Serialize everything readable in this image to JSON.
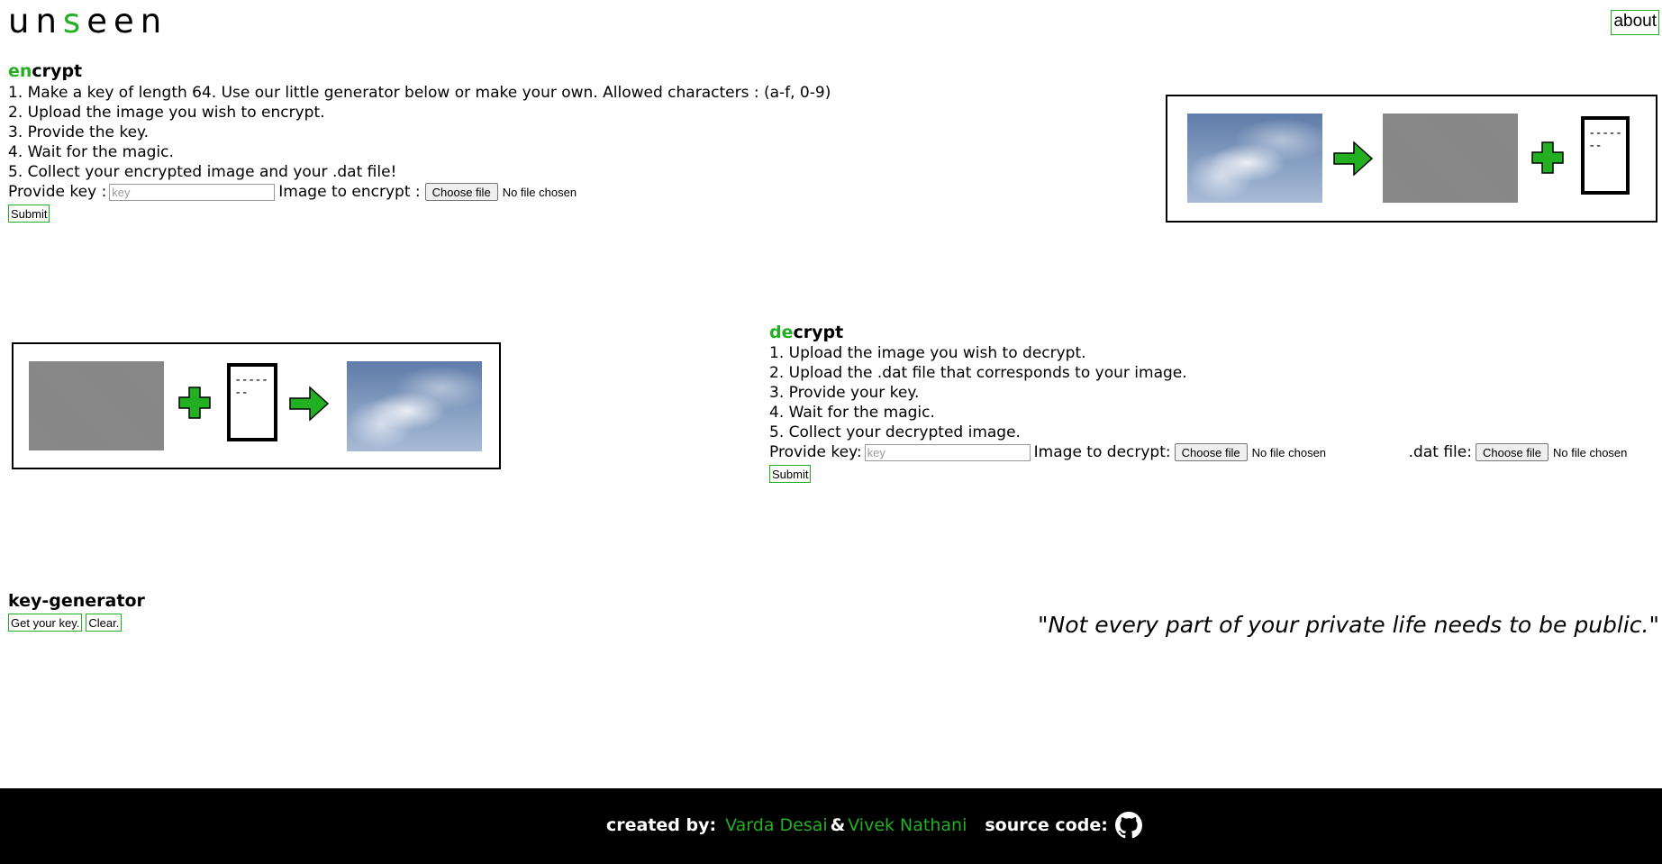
{
  "header": {
    "logo_parts": [
      "un",
      "s",
      "een"
    ],
    "about_label": "about"
  },
  "encrypt": {
    "title_accent": "en",
    "title_rest": "crypt",
    "steps": [
      "1. Make a key of length 64. Use our little generator below or make your own. Allowed characters : (a-f, 0-9)",
      "2. Upload the image you wish to encrypt.",
      "3. Provide the key.",
      "4. Wait for the magic.",
      "5. Collect your encrypted image and your .dat file!"
    ],
    "key_label": "Provide key :",
    "key_placeholder": "key",
    "image_label": "Image to encrypt :",
    "choose_file_label": "Choose file",
    "file_status": "No file chosen",
    "submit_label": "Submit"
  },
  "decrypt": {
    "title_accent": "de",
    "title_rest": "crypt",
    "steps": [
      "1. Upload the image you wish to decrypt.",
      "2. Upload the .dat file that corresponds to your image.",
      "3. Provide your key.",
      "4. Wait for the magic.",
      "5. Collect your decrypted image."
    ],
    "key_label": "Provide key:",
    "key_placeholder": "key",
    "image_label": "Image to decrypt:",
    "choose_file_label": "Choose file",
    "file_status": "No file chosen",
    "dat_label": ".dat file:",
    "dat_choose_file_label": "Choose file",
    "dat_file_status": "No file chosen",
    "submit_label": "Submit"
  },
  "diagram": {
    "doc_text_line1": "-----",
    "doc_text_line2": "--"
  },
  "keygen": {
    "title": "key-generator",
    "get_key_label": "Get your key.",
    "clear_label": "Clear."
  },
  "quote": "\"Not every part of your private life needs to be public.\"",
  "footer": {
    "created_by_label": "created by:",
    "author1": "Varda Desai",
    "ampersand": "&",
    "author2": "Vivek Nathani",
    "source_label": "source code:"
  },
  "colors": {
    "accent": "#22b022",
    "footer_bg": "#000000"
  }
}
